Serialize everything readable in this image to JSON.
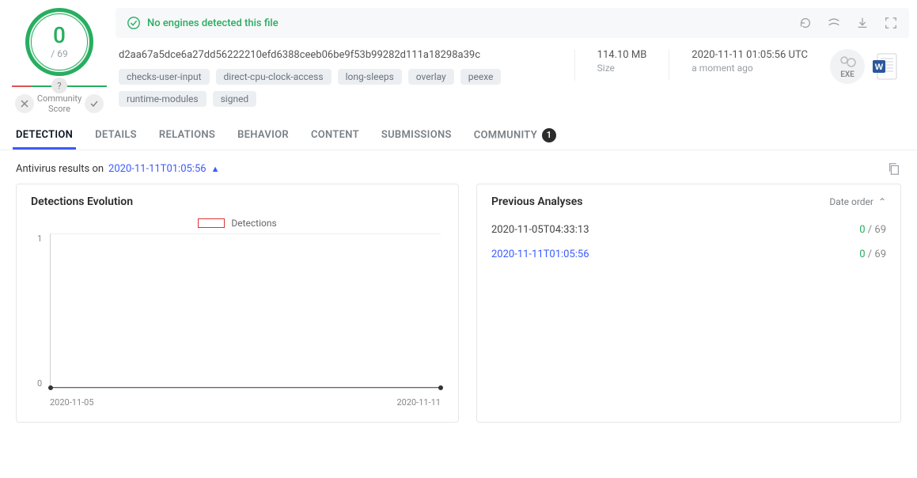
{
  "score": {
    "detections": "0",
    "total": "/ 69"
  },
  "community_label": "Community\nScore",
  "banner": {
    "message": "No engines detected this file"
  },
  "file": {
    "hash": "d2aa67a5dce6a27dd56222210efd6388ceeb06be9f53b99282d111a18298a39c",
    "tags": [
      "checks-user-input",
      "direct-cpu-clock-access",
      "long-sleeps",
      "overlay",
      "peexe",
      "runtime-modules",
      "signed"
    ],
    "size_value": "114.10 MB",
    "size_label": "Size",
    "scan_date": "2020-11-11 01:05:56 UTC",
    "scan_ago": "a moment ago",
    "exe_label": "EXE"
  },
  "tabs": {
    "items": [
      {
        "label": "DETECTION",
        "active": true
      },
      {
        "label": "DETAILS"
      },
      {
        "label": "RELATIONS"
      },
      {
        "label": "BEHAVIOR"
      },
      {
        "label": "CONTENT"
      },
      {
        "label": "SUBMISSIONS"
      },
      {
        "label": "COMMUNITY",
        "count": "1"
      }
    ]
  },
  "subheader": {
    "prefix": "Antivirus results on",
    "ts": "2020-11-11T01:05:56"
  },
  "evolution": {
    "title": "Detections Evolution",
    "legend": "Detections",
    "y_top": "1",
    "y_bottom": "0",
    "x_left": "2020-11-05",
    "x_right": "2020-11-11"
  },
  "previous": {
    "title": "Previous Analyses",
    "sorter": "Date order",
    "rows": [
      {
        "ts": "2020-11-05T04:33:13",
        "detections": "0",
        "total": "/ 69",
        "active": false
      },
      {
        "ts": "2020-11-11T01:05:56",
        "detections": "0",
        "total": "/ 69",
        "active": true
      }
    ]
  },
  "chart_data": {
    "type": "line",
    "title": "Detections Evolution",
    "xlabel": "",
    "ylabel": "",
    "ylim": [
      0,
      1
    ],
    "x": [
      "2020-11-05",
      "2020-11-11"
    ],
    "series": [
      {
        "name": "Detections",
        "values": [
          0,
          0
        ]
      }
    ]
  }
}
